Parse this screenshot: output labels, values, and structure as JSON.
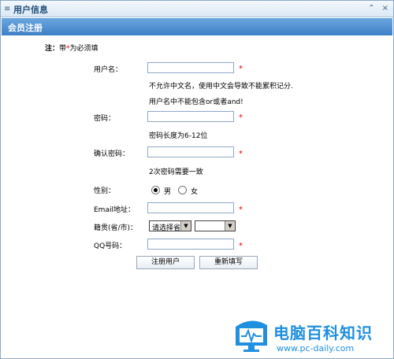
{
  "window": {
    "title": "用户信息",
    "grip": "≡",
    "collapse_icon": "⌃",
    "close_icon": "×"
  },
  "section": {
    "title": "会员注册"
  },
  "note": {
    "prefix": "注：",
    "text_before": "带",
    "star": "*",
    "text_after": "为必须填"
  },
  "form": {
    "username": {
      "label": "用户名：",
      "value": "",
      "required": "*",
      "hint1": "不允许中文名，使用中文会导致不能累积记分.",
      "hint2": "用户名中不能包含or或者and!"
    },
    "password": {
      "label": "密码：",
      "value": "",
      "required": "*",
      "hint": "密码长度为6-12位"
    },
    "confirm": {
      "label": "确认密码：",
      "value": "",
      "required": "*",
      "hint": "2次密码需要一致"
    },
    "gender": {
      "label": "性别：",
      "options": [
        "男",
        "女"
      ],
      "selected": "男"
    },
    "email": {
      "label": "Email地址：",
      "value": "",
      "required": "*"
    },
    "origin": {
      "label": "籍贯(省/市)：",
      "province": "请选择省",
      "city": ""
    },
    "qq": {
      "label": "QQ号码：",
      "value": "",
      "required": "*"
    }
  },
  "buttons": {
    "submit": "注册用户",
    "reset": "重新填写"
  },
  "watermark": {
    "name": "电脑百科知识",
    "url": "www.pc-daily.com"
  },
  "colors": {
    "header_blue": "#3e80c7",
    "required_red": "#e00000",
    "logo_blue": "#1f8fe0"
  }
}
